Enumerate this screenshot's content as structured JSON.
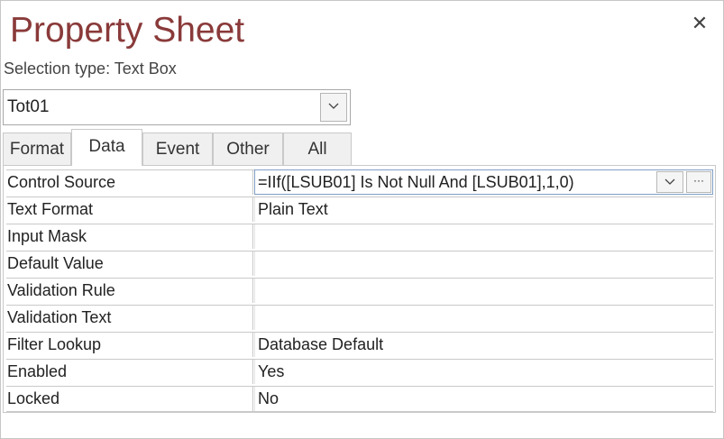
{
  "panel": {
    "title": "Property Sheet",
    "selection_type": "Selection type: Text Box",
    "close_icon": "close-icon"
  },
  "object_combo": {
    "value": "Tot01",
    "dropdown_icon": "chevron-down-icon"
  },
  "tabs": [
    {
      "label": "Format",
      "active": false
    },
    {
      "label": "Data",
      "active": true
    },
    {
      "label": "Event",
      "active": false
    },
    {
      "label": "Other",
      "active": false
    },
    {
      "label": "All",
      "active": false
    }
  ],
  "properties": [
    {
      "label": "Control Source",
      "value": "=IIf([LSUB01] Is Not Null And [LSUB01],1,0)"
    },
    {
      "label": "Text Format",
      "value": "Plain Text"
    },
    {
      "label": "Input Mask",
      "value": ""
    },
    {
      "label": "Default Value",
      "value": ""
    },
    {
      "label": "Validation Rule",
      "value": ""
    },
    {
      "label": "Validation Text",
      "value": ""
    },
    {
      "label": "Filter Lookup",
      "value": "Database Default"
    },
    {
      "label": "Enabled",
      "value": "Yes"
    },
    {
      "label": "Locked",
      "value": "No"
    }
  ],
  "control_source_buttons": {
    "dropdown_icon": "chevron-down-icon",
    "builder_label": "···"
  },
  "colors": {
    "title": "#8a3a3a",
    "selection_border": "#7f9fc5"
  }
}
